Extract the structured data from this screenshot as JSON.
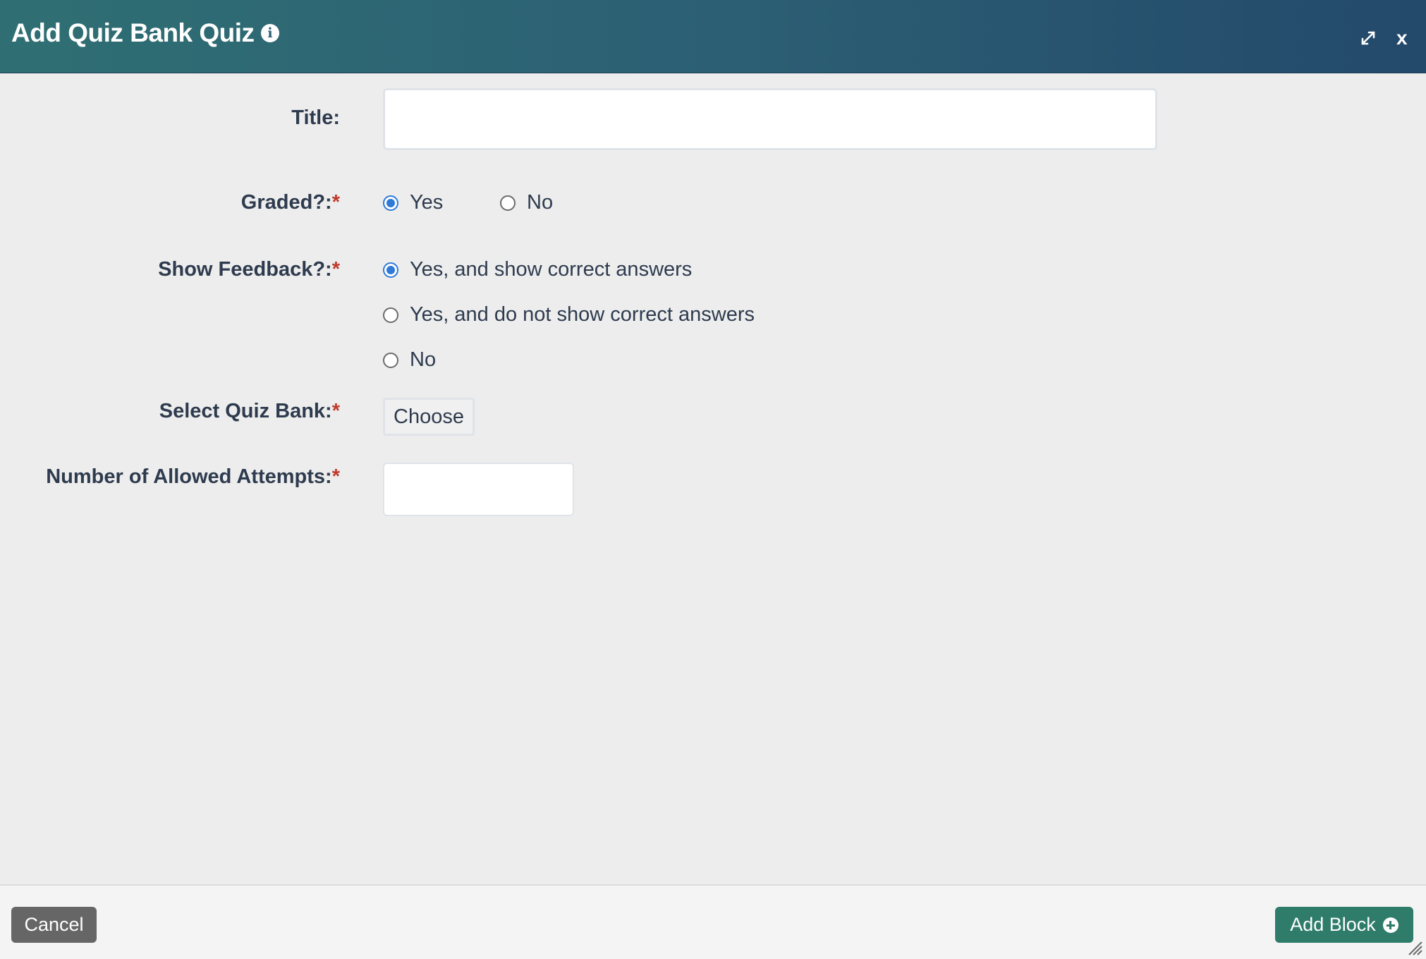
{
  "dialog": {
    "title": "Add Quiz Bank Quiz",
    "info_icon": "info-icon",
    "maximize_icon": "expand-icon",
    "close_label": "x"
  },
  "form": {
    "title_label": "Title:",
    "title_value": "",
    "graded_label": "Graded?:",
    "graded_options": [
      "Yes",
      "No"
    ],
    "graded_selected": "Yes",
    "feedback_label": "Show Feedback?:",
    "feedback_options": [
      "Yes, and show correct answers",
      "Yes, and do not show correct answers",
      "No"
    ],
    "feedback_selected": "Yes, and show correct answers",
    "quiz_bank_label": "Select Quiz Bank:",
    "choose_label": "Choose",
    "attempts_label": "Number of Allowed Attempts:",
    "attempts_value": "",
    "required_mark": "*"
  },
  "footer": {
    "cancel_label": "Cancel",
    "add_block_label": "Add Block"
  },
  "colors": {
    "header_start": "#2f6f73",
    "header_end": "#23496b",
    "required": "#c0392b",
    "radio_checked": "#2f7ad9",
    "add_button": "#2f7c6b",
    "cancel_button": "#666666"
  }
}
